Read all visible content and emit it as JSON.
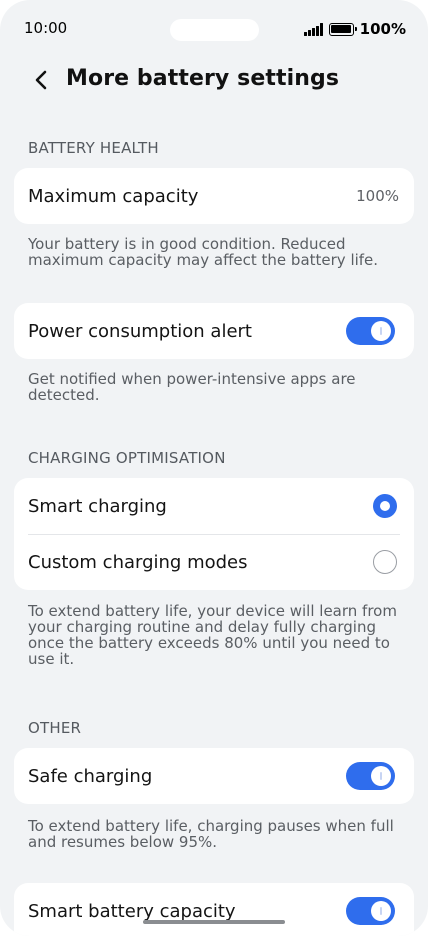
{
  "status_bar": {
    "time": "10:00",
    "battery_percent": "100%",
    "icons": [
      "signal-icon",
      "battery-icon"
    ]
  },
  "header": {
    "back_icon": "chevron-left-icon",
    "title": "More battery settings"
  },
  "battery_health": {
    "section_title": "BATTERY HEALTH",
    "max_capacity_label": "Maximum capacity",
    "max_capacity_value": "100%",
    "description": "Your battery is in good condition. Reduced maximum capacity may affect the battery life."
  },
  "power_alert": {
    "label": "Power consumption alert",
    "enabled": true,
    "description": "Get notified when power-intensive apps are detected."
  },
  "charging_optimisation": {
    "section_title": "CHARGING OPTIMISATION",
    "options": [
      {
        "label": "Smart charging",
        "selected": true
      },
      {
        "label": "Custom charging modes",
        "selected": false
      }
    ],
    "description": "To extend battery life, your device will learn from your charging routine and delay fully charging once the battery exceeds 80% until you need to use it."
  },
  "other": {
    "section_title": "OTHER",
    "safe_charging_label": "Safe charging",
    "safe_charging_enabled": true,
    "safe_charging_description": "To extend battery life, charging pauses when full and resumes below 95%.",
    "smart_capacity_label": "Smart battery capacity",
    "smart_capacity_enabled": true
  },
  "colors": {
    "accent": "#2f6ded",
    "background": "#f1f3f5",
    "card": "#ffffff"
  }
}
